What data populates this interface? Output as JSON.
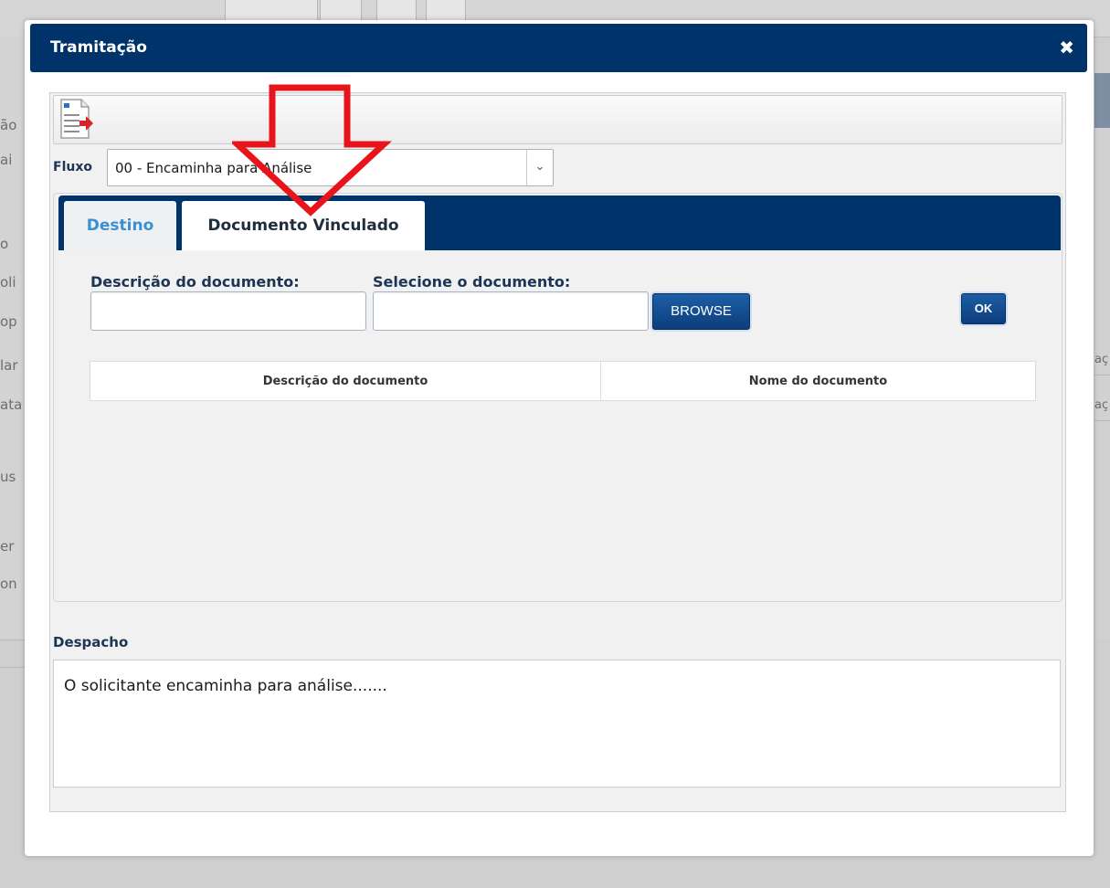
{
  "background": {
    "left_fragments": [
      "ão",
      "ai",
      "o",
      "oli",
      "op",
      "lar",
      "ata",
      "us",
      "er",
      "on"
    ],
    "right_fragments": [
      "aç",
      "aç"
    ]
  },
  "modal": {
    "title": "Tramitação",
    "close_symbol": "✖"
  },
  "fluxo": {
    "label": "Fluxo",
    "selected": "00 - Encaminha para Análise"
  },
  "tabs": [
    {
      "label": "Destino",
      "active": false
    },
    {
      "label": "Documento Vinculado",
      "active": true
    }
  ],
  "document_form": {
    "descricao_label": "Descrição do documento:",
    "descricao_value": "",
    "selecione_label": "Selecione o documento:",
    "selecione_value": "",
    "browse_label": "BROWSE",
    "ok_label": "OK"
  },
  "doc_table": {
    "columns": [
      "Descrição do documento",
      "Nome do documento"
    ],
    "rows": []
  },
  "despacho": {
    "label": "Despacho",
    "text": "O solicitante encaminha para análise......."
  },
  "colors": {
    "header_blue": "#00336a",
    "tab_link_blue": "#3b91cf",
    "annotation_red": "#e8141b"
  }
}
